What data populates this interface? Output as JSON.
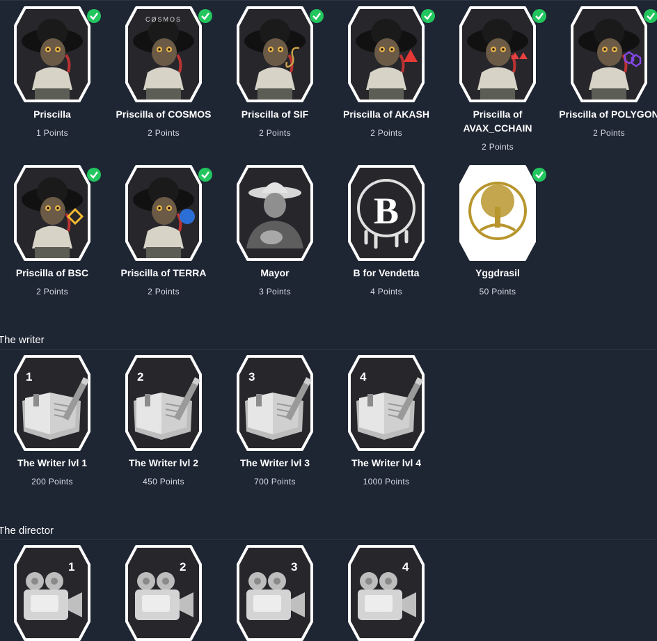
{
  "row1": [
    {
      "title": "Priscilla",
      "points": "1 Points",
      "checked": true,
      "chain": ""
    },
    {
      "title": "Priscilla of COSMOS",
      "points": "2 Points",
      "checked": true,
      "chain": "CØSMOS"
    },
    {
      "title": "Priscilla of SIF",
      "points": "2 Points",
      "checked": true,
      "chain": ""
    },
    {
      "title": "Priscilla of AKASH",
      "points": "2 Points",
      "checked": true,
      "chain": ""
    },
    {
      "title_line1": "Priscilla of",
      "title_line2": "AVAX_CCHAIN",
      "points": "2 Points",
      "checked": true,
      "chain": ""
    },
    {
      "title": "Priscilla of POLYGON",
      "points": "2 Points",
      "checked": true,
      "chain": ""
    }
  ],
  "row2": [
    {
      "title": "Priscilla of BSC",
      "points": "2 Points",
      "checked": true
    },
    {
      "title": "Priscilla of TERRA",
      "points": "2 Points",
      "checked": true
    },
    {
      "title": "Mayor",
      "points": "3 Points",
      "checked": false
    },
    {
      "title": "B for Vendetta",
      "points": "4 Points",
      "checked": false
    },
    {
      "title": "Yggdrasil",
      "points": "50 Points",
      "checked": true
    }
  ],
  "sections": {
    "writer": "The writer",
    "director": "The director"
  },
  "writer": [
    {
      "num": "1",
      "title": "The Writer lvl 1",
      "points": "200 Points"
    },
    {
      "num": "2",
      "title": "The Writer lvl 2",
      "points": "450 Points"
    },
    {
      "num": "3",
      "title": "The Writer lvl 3",
      "points": "700 Points"
    },
    {
      "num": "4",
      "title": "The Writer lvl 4",
      "points": "1000 Points"
    }
  ],
  "director": [
    {
      "num": "1"
    },
    {
      "num": "2"
    },
    {
      "num": "3"
    },
    {
      "num": "4"
    }
  ],
  "colors": {
    "background": "#1e2533",
    "badge_bg": "#26262b",
    "check": "#22c55e",
    "frame": "#ffffff"
  }
}
